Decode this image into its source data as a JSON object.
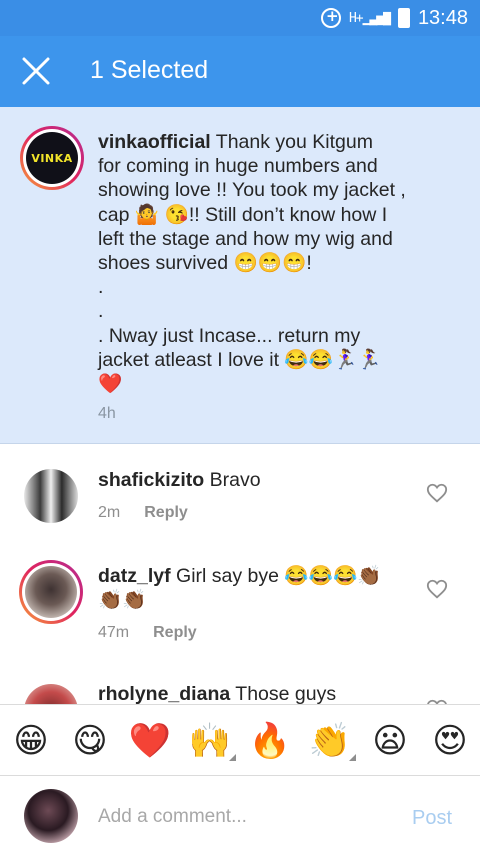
{
  "status_bar": {
    "network": "H+",
    "time": "13:48",
    "icons": [
      "data-saver-icon",
      "signal-icon",
      "battery-icon"
    ]
  },
  "header": {
    "title": "1 Selected",
    "close_icon": "close-icon"
  },
  "post": {
    "username": "vinkaofficial",
    "avatar_label": "VINKA",
    "lines": [
      " Thank you Kitgum",
      "for coming in huge numbers and",
      "showing love !! You took my jacket ,",
      "cap 🤷 😘!! Still don’t know how I",
      "left the stage and how my wig and",
      "shoes survived 😁😁😁!",
      ".",
      ".",
      ". Nway just Incase... return my",
      "jacket atleast I love it 😂😂🏃‍♀️🏃‍♀️",
      "❤️"
    ],
    "time": "4h"
  },
  "comments": [
    {
      "username": "shafickizito",
      "text": " Bravo",
      "time": "2m",
      "reply_label": "Reply"
    },
    {
      "username": "datz_lyf",
      "text": " Girl say bye 😂😂😂👏🏾",
      "text2": "👏🏾👏🏾",
      "time": "47m",
      "reply_label": "Reply"
    },
    {
      "username": "rholyne_diana",
      "text": " Those guys"
    }
  ],
  "emoji_bar": {
    "emojis": [
      "😁",
      "😋",
      "❤️",
      "🙌",
      "🔥",
      "👏",
      "😦",
      "😍"
    ]
  },
  "composer": {
    "placeholder": "Add a comment...",
    "post_label": "Post"
  },
  "colors": {
    "status_bar": "#3a8ee6",
    "header": "#3d95ec",
    "selected_bg": "#dce9fb",
    "post_button": "#a9cdf0"
  }
}
